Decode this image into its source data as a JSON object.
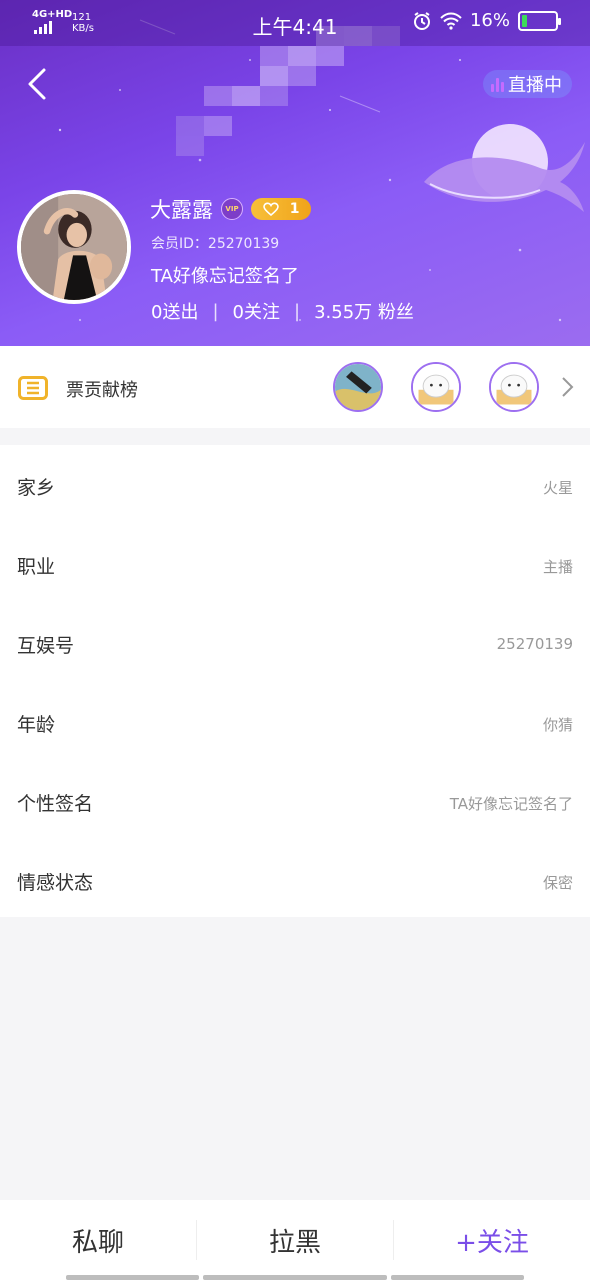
{
  "status_bar": {
    "network": "4G+HD",
    "speed_value": "121",
    "speed_unit": "KB/s",
    "time": "上午4:41",
    "battery": "16%",
    "battery_level": 0.16,
    "icons": [
      "alarm-icon",
      "wifi-icon",
      "battery-icon"
    ]
  },
  "header": {
    "live_badge": "直播中",
    "nickname": "大露露",
    "vip_badge": "VIP",
    "level": "1",
    "member_id": "会员ID：25270139",
    "signature": "TA好像忘记签名了",
    "stats": {
      "sent": "0送出",
      "following": "0关注",
      "fans": "3.55万 粉丝"
    },
    "colors": {
      "gradient_start": "#6a2fc4",
      "gradient_end": "#9b6cf0"
    }
  },
  "contribution": {
    "label": "票贡献榜",
    "icon": "ticket-icon",
    "fans": [
      "fan-avatar-1",
      "fan-avatar-2",
      "fan-avatar-3"
    ]
  },
  "info": [
    {
      "label": "家乡",
      "value": "火星"
    },
    {
      "label": "职业",
      "value": "主播"
    },
    {
      "label": "互娱号",
      "value": "25270139"
    },
    {
      "label": "年龄",
      "value": "你猜"
    },
    {
      "label": "个性签名",
      "value": "TA好像忘记签名了"
    },
    {
      "label": "情感状态",
      "value": "保密"
    }
  ],
  "bottom_bar": {
    "chat": "私聊",
    "block": "拉黑",
    "follow": "+关注",
    "follow_color": "#7a4ee8"
  }
}
